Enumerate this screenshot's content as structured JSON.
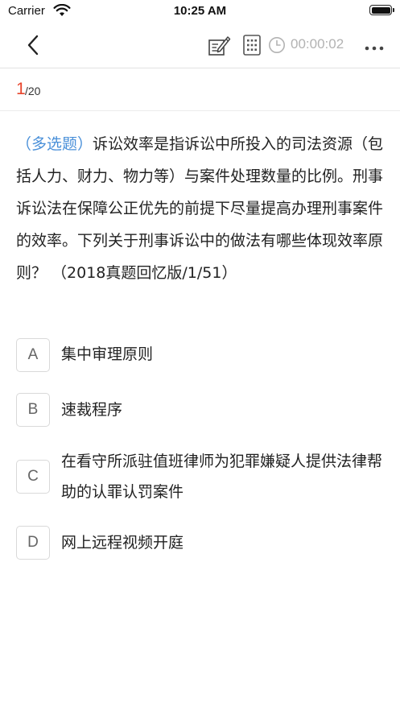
{
  "status_bar": {
    "carrier": "Carrier",
    "time": "10:25 AM"
  },
  "nav": {
    "timer": "00:00:02",
    "icons": [
      "back-chevron-icon",
      "edit-notes-icon",
      "answer-card-grid-icon",
      "clock-icon",
      "more-dots-icon"
    ]
  },
  "progress": {
    "current": "1",
    "total": "/20"
  },
  "question": {
    "type": "（多选题）",
    "text": "诉讼效率是指诉讼中所投入的司法资源（包括人力、财力、物力等）与案件处理数量的比例。刑事诉讼法在保障公正优先的前提下尽量提高办理刑事案件的效率。下列关于刑事诉讼中的做法有哪些体现效率原则？ （2018真题回忆版/1/51）"
  },
  "options": [
    {
      "letter": "A",
      "text": "集中审理原则"
    },
    {
      "letter": "B",
      "text": "速裁程序"
    },
    {
      "letter": "C",
      "text": "在看守所派驻值班律师为犯罪嫌疑人提供法律帮助的认罪认罚案件"
    },
    {
      "letter": "D",
      "text": "网上远程视频开庭"
    }
  ],
  "colors": {
    "accent_blue": "#4a90d9",
    "progress_red": "#e8452c",
    "timer_gray": "#b3b3b3"
  }
}
